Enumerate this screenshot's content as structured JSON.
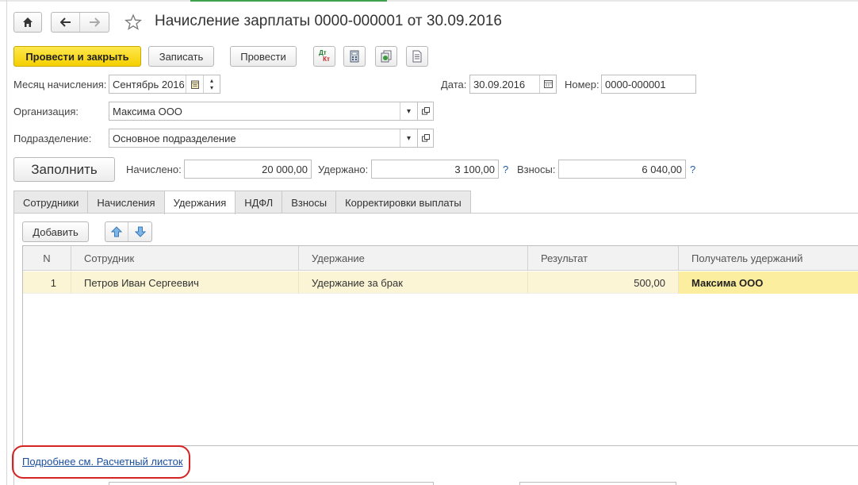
{
  "window": {
    "title": "Начисление зарплаты 0000-000001 от 30.09.2016",
    "nav": {
      "home_icon": "home-icon",
      "back_icon": "arrow-left-icon",
      "forward_icon": "arrow-right-icon",
      "favorite_icon": "star-outline-icon"
    }
  },
  "toolbar": {
    "post_and_close_label": "Провести и закрыть",
    "save_label": "Записать",
    "post_label": "Провести",
    "dtkt_icon_text_top": "Дт",
    "dtkt_icon_text_bottom": "Кт",
    "icons": [
      "dt-kt-icon",
      "calculator-icon",
      "related-docs-icon",
      "print-document-icon"
    ]
  },
  "form": {
    "month_label": "Месяц начисления:",
    "month_value": "Сентябрь 2016",
    "date_label": "Дата:",
    "date_value": "30.09.2016",
    "number_label": "Номер:",
    "number_value": "0000-000001",
    "org_label": "Организация:",
    "org_value": "Максима ООО",
    "dept_label": "Подразделение:",
    "dept_value": "Основное подразделение"
  },
  "summary": {
    "fill_label": "Заполнить",
    "accrued_label": "Начислено:",
    "accrued_value": "20 000,00",
    "withheld_label": "Удержано:",
    "withheld_value": "3 100,00",
    "contrib_label": "Взносы:",
    "contrib_value": "6 040,00",
    "help_mark": "?"
  },
  "tabs": [
    {
      "label": "Сотрудники",
      "active": false
    },
    {
      "label": "Начисления",
      "active": false
    },
    {
      "label": "Удержания",
      "active": true
    },
    {
      "label": "НДФЛ",
      "active": false
    },
    {
      "label": "Взносы",
      "active": false
    },
    {
      "label": "Корректировки выплаты",
      "active": false
    }
  ],
  "table_toolbar": {
    "add_label": "Добавить",
    "move_up_icon": "arrow-up-icon",
    "move_down_icon": "arrow-down-icon"
  },
  "table": {
    "columns": [
      "N",
      "Сотрудник",
      "Удержание",
      "Результат",
      "Получатель удержаний"
    ],
    "rows": [
      {
        "n": "1",
        "employee": "Петров Иван Сергеевич",
        "deduction": "Удержание за брак",
        "result": "500,00",
        "recipient": "Максима ООО"
      }
    ]
  },
  "footer": {
    "details_link": "Подробнее см. Расчетный листок",
    "highlight_color": "#d42424"
  },
  "colors": {
    "accent_yellow": "#f4cf00",
    "row_highlight": "#fbf5d6",
    "link_blue": "#1a4fa0"
  }
}
